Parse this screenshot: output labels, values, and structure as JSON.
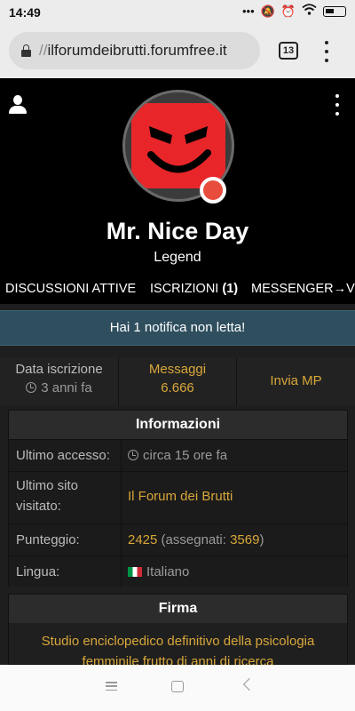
{
  "status_bar": {
    "time": "14:49",
    "icons": [
      "dots-icon",
      "mute-icon",
      "alarm-icon",
      "wifi-icon",
      "battery-icon"
    ]
  },
  "browser": {
    "url_scheme": "//",
    "url_host": "ilforumdeibrutti.forumfree.it",
    "tab_count": "13"
  },
  "profile": {
    "username": "Mr. Nice Day",
    "rank": "Legend",
    "status_color": "#e74c3c",
    "tabs": [
      {
        "label": "DISCUSSIONI ATTIVE",
        "count": ""
      },
      {
        "label": "ISCRIZIONI",
        "count": "(1)"
      },
      {
        "label": "MESSENGER→VC",
        "count": ""
      }
    ]
  },
  "notification": {
    "text": "Hai 1 notifica non letta!"
  },
  "stats": {
    "joined_label": "Data iscrizione",
    "joined_value": "3 anni fa",
    "messages_label": "Messaggi",
    "messages_value": "6.666",
    "pm_label": "Invia MP"
  },
  "info": {
    "title": "Informazioni",
    "last_access_label": "Ultimo accesso:",
    "last_access_value": "circa 15 ore fa",
    "last_site_label_1": "Ultimo sito",
    "last_site_label_2": "visitato:",
    "last_site_value": "Il Forum dei Brutti",
    "score_label": "Punteggio:",
    "score_value": "2425",
    "score_assigned_prefix": "(assegnati: ",
    "score_assigned_value": "3569",
    "score_assigned_suffix": ")",
    "language_label": "Lingua:",
    "language_value": "Italiano"
  },
  "signature": {
    "title": "Firma",
    "text": "Studio enciclopedico definitivo della psicologia femminile frutto di anni di ricerca"
  },
  "colors": {
    "accent_gold": "#d8a73a",
    "notification_bg": "#2f4f5f",
    "avatar_red": "#e8262a"
  }
}
